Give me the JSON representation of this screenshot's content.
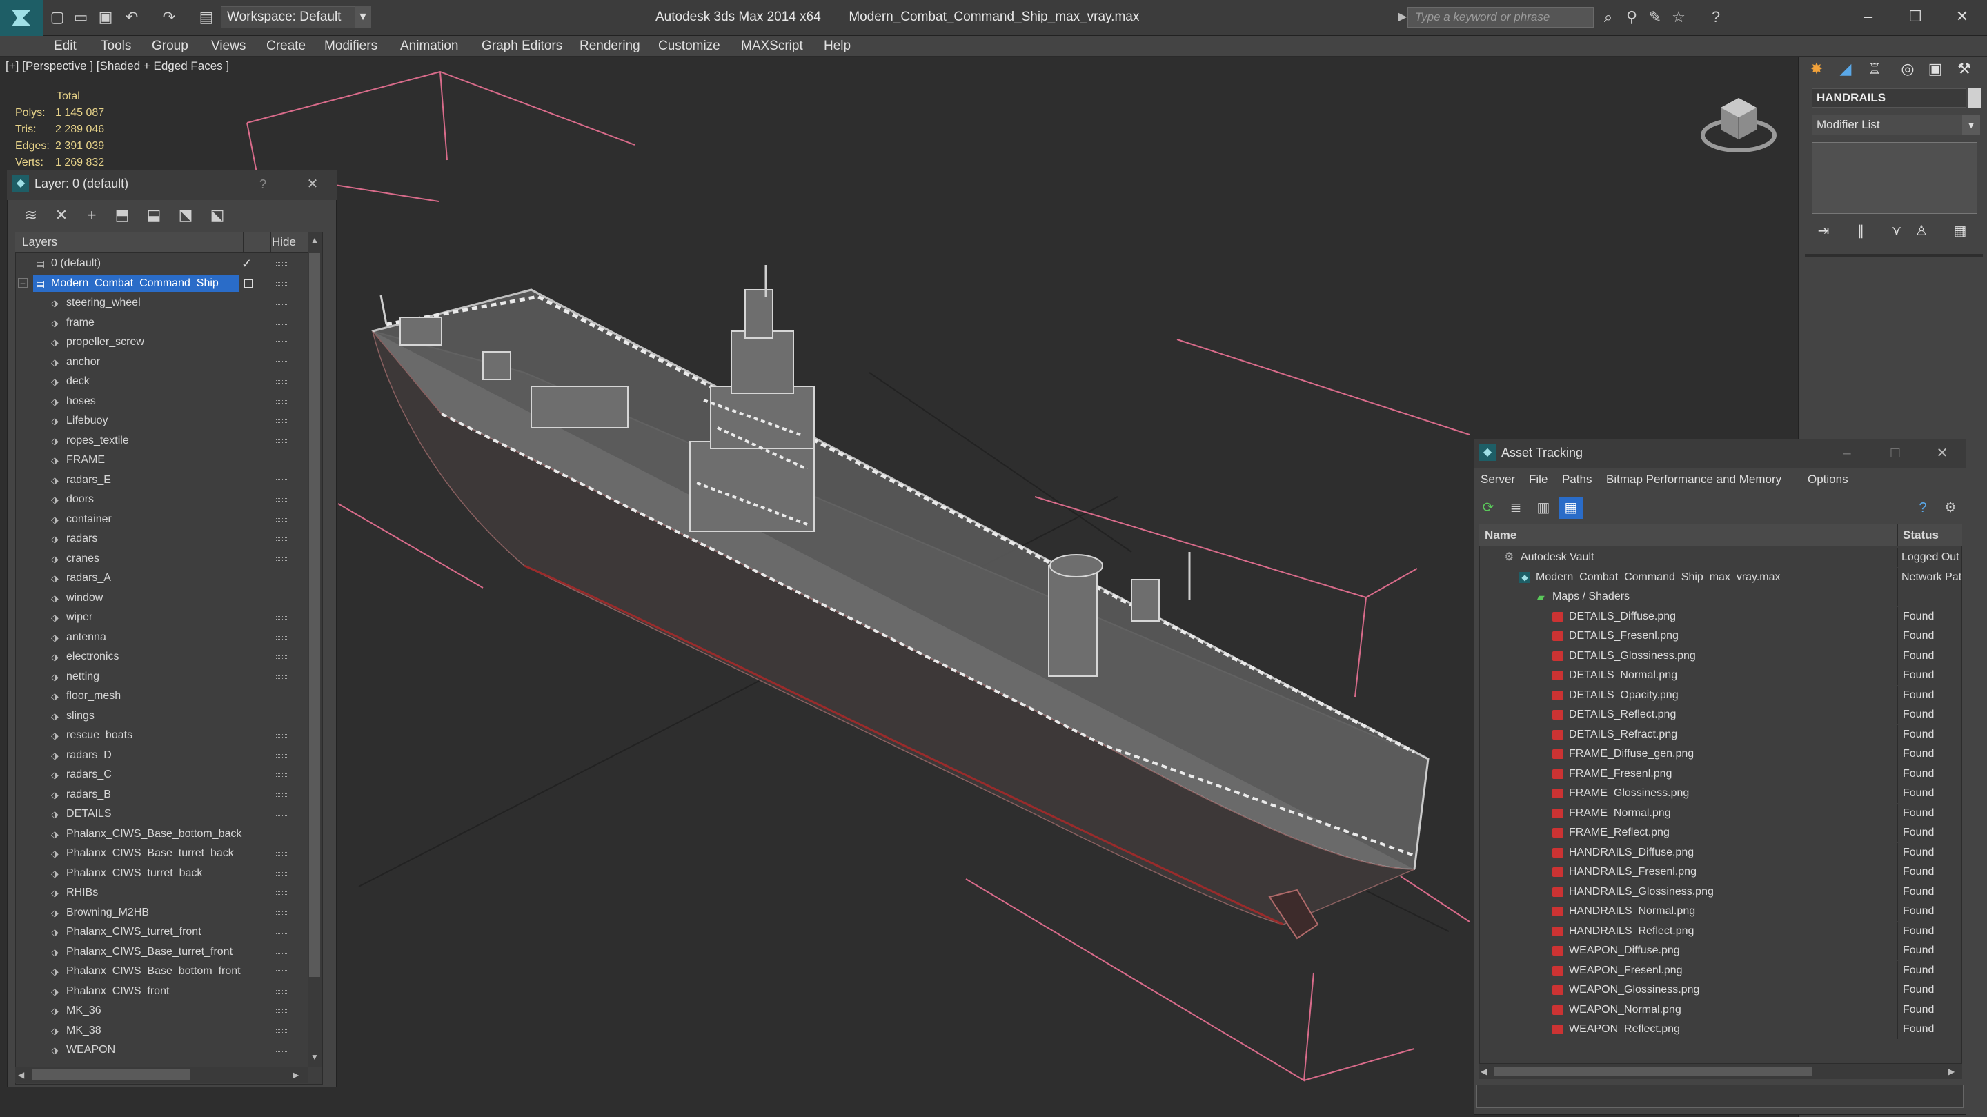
{
  "titlebar": {
    "workspace": "Workspace: Default",
    "app_name": "Autodesk 3ds Max  2014 x64",
    "file_name": "Modern_Combat_Command_Ship_max_vray.max",
    "search_placeholder": "Type a keyword or phrase"
  },
  "menu": [
    "Edit",
    "Tools",
    "Group",
    "Views",
    "Create",
    "Modifiers",
    "Animation",
    "Graph Editors",
    "Rendering",
    "Customize",
    "MAXScript",
    "Help"
  ],
  "viewport": {
    "label": "[+] [Perspective ] [Shaded + Edged Faces ]",
    "stats_title": "Total",
    "stats": [
      {
        "label": "Polys:",
        "value": "1 145 087"
      },
      {
        "label": "Tris:",
        "value": "2 289 046"
      },
      {
        "label": "Edges:",
        "value": "2 391 039"
      },
      {
        "label": "Verts:",
        "value": "1 269 832"
      }
    ]
  },
  "command_panel": {
    "object_name": "HANDRAILS",
    "modifier_list": "Modifier List"
  },
  "layer_dialog": {
    "title": "Layer: 0 (default)",
    "help": "?",
    "col_layers": "Layers",
    "col_hide": "Hide",
    "default_layer": "0 (default)",
    "selected_layer": "Modern_Combat_Command_Ship",
    "children": [
      "steering_wheel",
      "frame",
      "propeller_screw",
      "anchor",
      "deck",
      "hoses",
      "Lifebuoy",
      "ropes_textile",
      "FRAME",
      "radars_E",
      "doors",
      "container",
      "radars",
      "cranes",
      "radars_A",
      "window",
      "wiper",
      "antenna",
      "electronics",
      "netting",
      "floor_mesh",
      "slings",
      "rescue_boats",
      "radars_D",
      "radars_C",
      "radars_B",
      "DETAILS",
      "Phalanx_CIWS_Base_bottom_back",
      "Phalanx_CIWS_Base_turret_back",
      "Phalanx_CIWS_turret_back",
      "RHIBs",
      "Browning_M2HB",
      "Phalanx_CIWS_turret_front",
      "Phalanx_CIWS_Base_turret_front",
      "Phalanx_CIWS_Base_bottom_front",
      "Phalanx_CIWS_front",
      "MK_36",
      "MK_38",
      "WEAPON"
    ]
  },
  "asset_dialog": {
    "title": "Asset Tracking",
    "menu": [
      "Server",
      "File",
      "Paths",
      "Bitmap Performance and Memory",
      "Options"
    ],
    "col_name": "Name",
    "col_status": "Status",
    "vault": {
      "name": "Autodesk Vault",
      "status": "Logged Out"
    },
    "file": {
      "name": "Modern_Combat_Command_Ship_max_vray.max",
      "status": "Network Path"
    },
    "maps_folder": "Maps / Shaders",
    "maps": [
      {
        "name": "DETAILS_Diffuse.png",
        "status": "Found"
      },
      {
        "name": "DETAILS_Fresenl.png",
        "status": "Found"
      },
      {
        "name": "DETAILS_Glossiness.png",
        "status": "Found"
      },
      {
        "name": "DETAILS_Normal.png",
        "status": "Found"
      },
      {
        "name": "DETAILS_Opacity.png",
        "status": "Found"
      },
      {
        "name": "DETAILS_Reflect.png",
        "status": "Found"
      },
      {
        "name": "DETAILS_Refract.png",
        "status": "Found"
      },
      {
        "name": "FRAME_Diffuse_gen.png",
        "status": "Found"
      },
      {
        "name": "FRAME_Fresenl.png",
        "status": "Found"
      },
      {
        "name": "FRAME_Glossiness.png",
        "status": "Found"
      },
      {
        "name": "FRAME_Normal.png",
        "status": "Found"
      },
      {
        "name": "FRAME_Reflect.png",
        "status": "Found"
      },
      {
        "name": "HANDRAILS_Diffuse.png",
        "status": "Found"
      },
      {
        "name": "HANDRAILS_Fresenl.png",
        "status": "Found"
      },
      {
        "name": "HANDRAILS_Glossiness.png",
        "status": "Found"
      },
      {
        "name": "HANDRAILS_Normal.png",
        "status": "Found"
      },
      {
        "name": "HANDRAILS_Reflect.png",
        "status": "Found"
      },
      {
        "name": "WEAPON_Diffuse.png",
        "status": "Found"
      },
      {
        "name": "WEAPON_Fresenl.png",
        "status": "Found"
      },
      {
        "name": "WEAPON_Glossiness.png",
        "status": "Found"
      },
      {
        "name": "WEAPON_Normal.png",
        "status": "Found"
      },
      {
        "name": "WEAPON_Reflect.png",
        "status": "Found"
      }
    ]
  },
  "colors": {
    "selection": "#2a6cc8",
    "stats_text": "#e8d48a",
    "gizmo_lines": "#d86b8a",
    "app_accent": "#1e5e66"
  }
}
